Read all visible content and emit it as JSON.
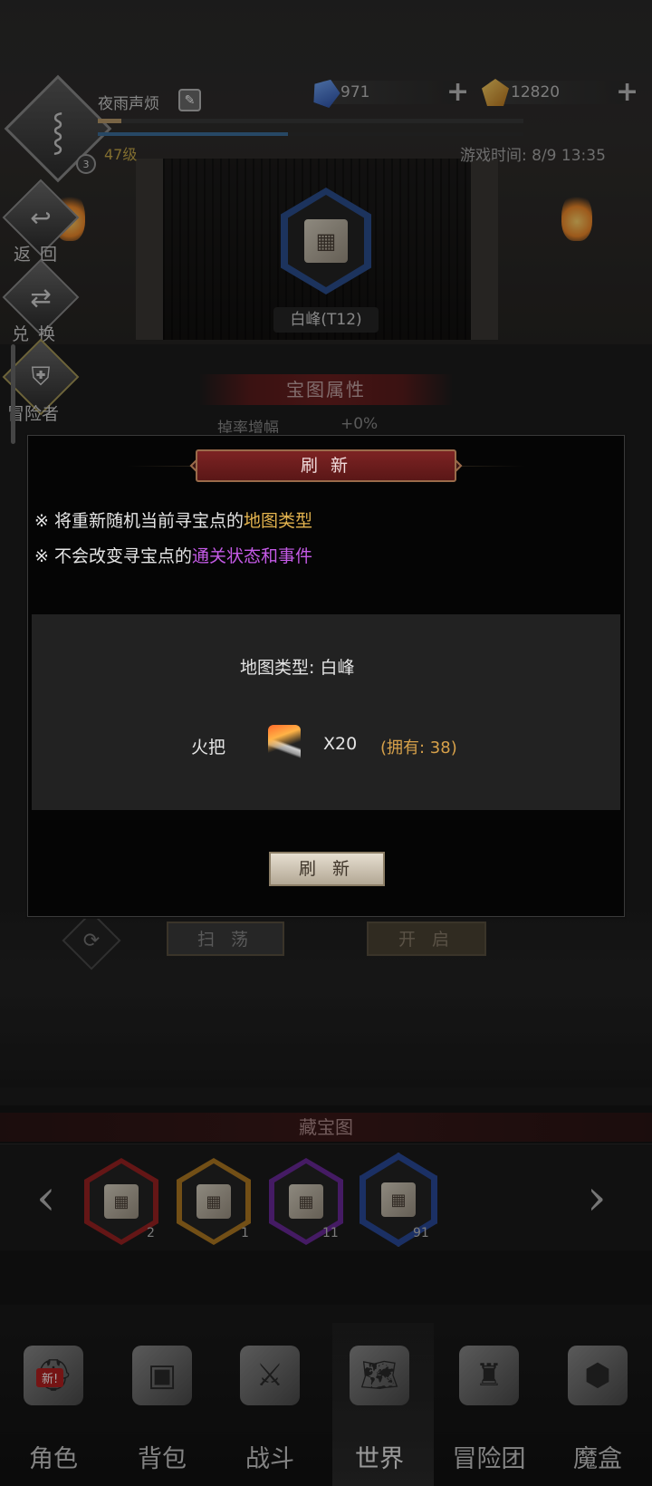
{
  "header": {
    "player_name": "夜雨声烦",
    "level": "47级",
    "avatar_badge": "3",
    "game_time": "游戏时间: 8/9 13:35",
    "gems": "971",
    "gold": "12820"
  },
  "side_menu": {
    "back": "返 回",
    "exchange": "兑 换",
    "adventurer": "冒险者"
  },
  "map": {
    "name": "白峰(T12)"
  },
  "behind": {
    "attr_title": "宝图属性",
    "attr_label": "掉率增幅",
    "attr_value": "+0%",
    "sweep": "扫 荡",
    "open": "开 启",
    "treasure_title": "藏宝图"
  },
  "treasure_maps": [
    {
      "count": "2",
      "color": "#9a2222"
    },
    {
      "count": "1",
      "color": "#b07a22"
    },
    {
      "count": "11",
      "color": "#6a2a9a"
    },
    {
      "count": "91",
      "color": "#2a4a9a"
    }
  ],
  "dialog": {
    "title": "刷 新",
    "note1_prefix": "※ 将重新随机当前寻宝点的",
    "note1_highlight": "地图类型",
    "note2_prefix": "※ 不会改变寻宝点的",
    "note2_highlight": "通关状态和事件",
    "map_type": "地图类型: 白峰",
    "cost_label": "火把",
    "cost_amount": "X20",
    "owned": "(拥有: 38)",
    "button": "刷 新"
  },
  "nav": {
    "new_badge": "新!",
    "tabs": [
      "角色",
      "背包",
      "战斗",
      "世界",
      "冒险团",
      "魔盒"
    ]
  },
  "colors": {
    "gold_highlight": "#e3b34e",
    "purple_highlight": "#c45ae6",
    "dialog_title_red": "#7d2323"
  }
}
